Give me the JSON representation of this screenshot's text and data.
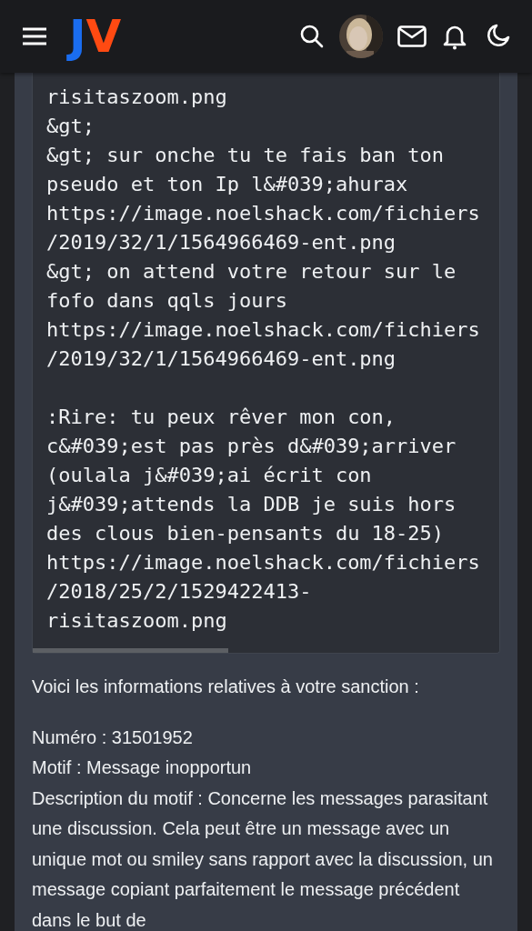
{
  "header": {
    "logo": [
      "J",
      "V"
    ]
  },
  "message": {
    "code": "risitaszoom.png\n&gt;\n&gt; sur onche tu te fais ban ton\npseudo et ton Ip l&#039;ahurax\nhttps://image.noelshack.com/fichiers\n/2019/32/1/1564966469-ent.png\n&gt; on attend votre retour sur le\nfofo dans qqls jours\nhttps://image.noelshack.com/fichiers\n/2019/32/1/1564966469-ent.png\n\n:Rire: tu peux rêver mon con,\nc&#039;est pas près d&#039;arriver\n(oulala j&#039;ai écrit con\nj&#039;attends la DDB je suis hors\ndes clous bien-pensants du 18-25)\nhttps://image.noelshack.com/fichiers\n/2018/25/2/1529422413-\nrisitaszoom.png",
    "intro": "Voici les informations relatives à votre sanction :",
    "details": [
      "Numéro : 31501952",
      "Motif : Message inopportun",
      "Description du motif : Concerne les messages parasitant une discussion. Cela peut être un message avec un unique mot ou smiley sans rapport avec la discussion, un message copiant parfaitement le message précédent dans le but de"
    ]
  }
}
